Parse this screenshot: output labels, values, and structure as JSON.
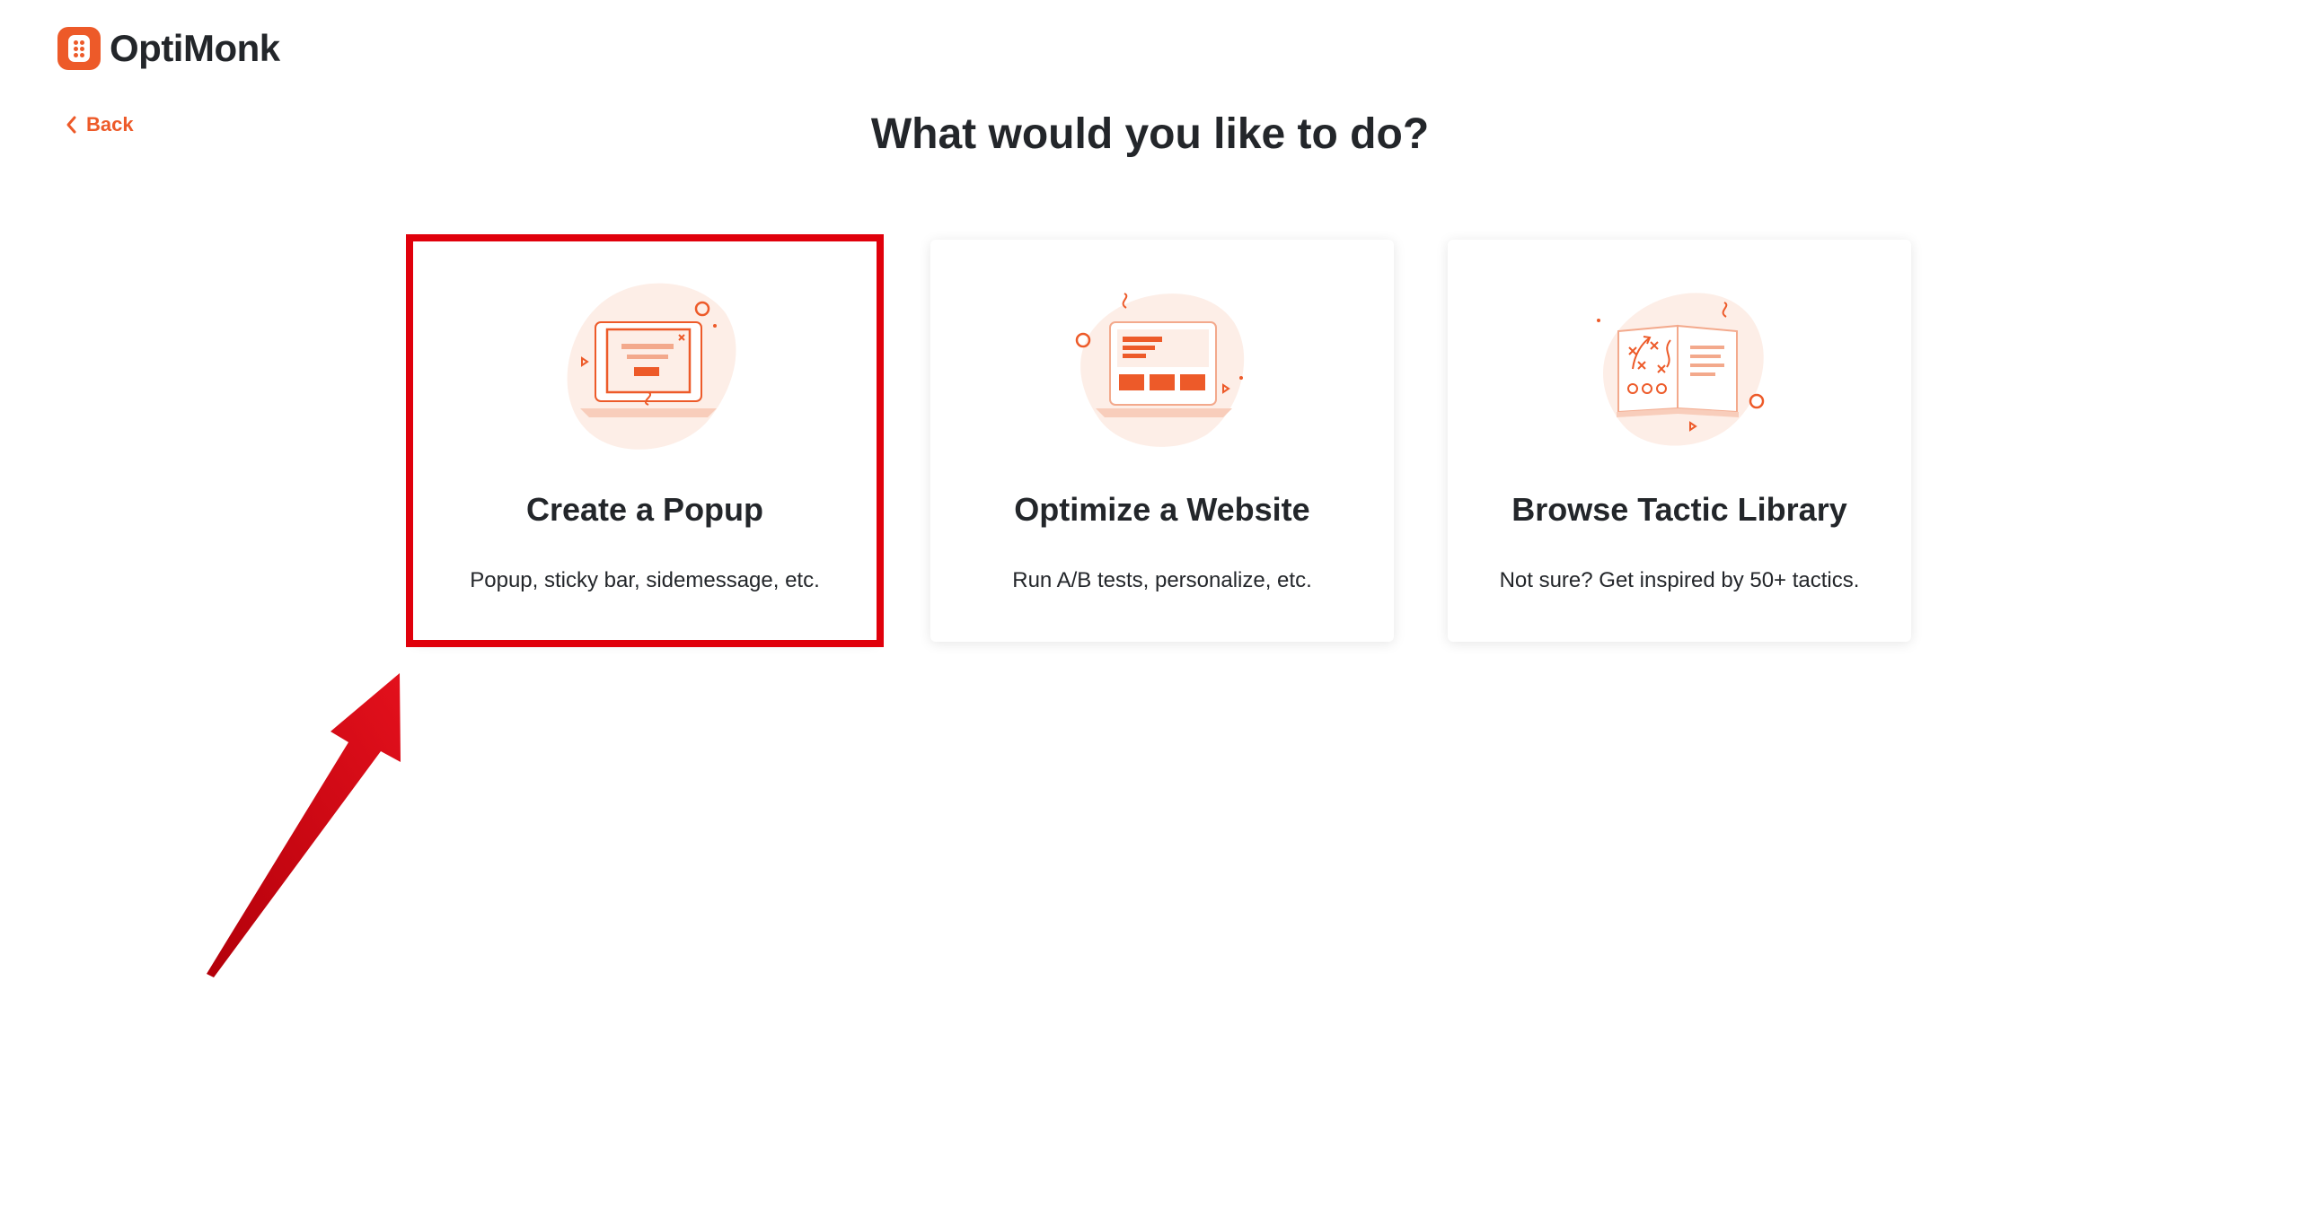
{
  "brand": {
    "name": "OptiMonk",
    "logo_icon": "optimonk-logo-icon",
    "accent_color": "#ed5a29"
  },
  "nav": {
    "back_label": "Back"
  },
  "page": {
    "heading": "What would you like to do?"
  },
  "options": [
    {
      "title": "Create a Popup",
      "description": "Popup, sticky bar, sidemessage, etc.",
      "icon": "laptop-popup-illustration",
      "highlighted": true
    },
    {
      "title": "Optimize a Website",
      "description": "Run A/B tests, personalize, etc.",
      "icon": "laptop-website-illustration",
      "highlighted": false
    },
    {
      "title": "Browse Tactic Library",
      "description": "Not sure? Get inspired by 50+ tactics.",
      "icon": "open-book-tactics-illustration",
      "highlighted": false
    }
  ],
  "annotation": {
    "highlight_color": "#e0000b",
    "arrow_icon": "red-pointer-arrow"
  }
}
